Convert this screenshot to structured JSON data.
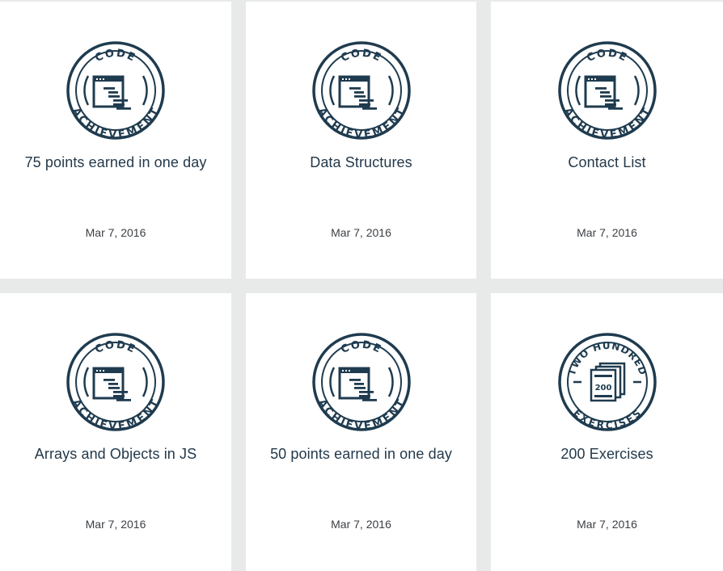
{
  "brand": {
    "badge_color": "#1f3b4f",
    "card_bg": "#ffffff",
    "page_bg": "#e8e9e9"
  },
  "achievements": [
    {
      "badge_type": "code-achievement",
      "badge_top_text": "CODE",
      "badge_bottom_text": "ACHIEVEMENT",
      "badge_number": "",
      "title": "75 points earned in one day",
      "date": "Mar 7, 2016"
    },
    {
      "badge_type": "code-achievement",
      "badge_top_text": "CODE",
      "badge_bottom_text": "ACHIEVEMENT",
      "badge_number": "",
      "title": "Data Structures",
      "date": "Mar 7, 2016"
    },
    {
      "badge_type": "code-achievement",
      "badge_top_text": "CODE",
      "badge_bottom_text": "ACHIEVEMENT",
      "badge_number": "",
      "title": "Contact List",
      "date": "Mar 7, 2016"
    },
    {
      "badge_type": "code-achievement",
      "badge_top_text": "CODE",
      "badge_bottom_text": "ACHIEVEMENT",
      "badge_number": "",
      "title": "Arrays and Objects in JS",
      "date": "Mar 7, 2016"
    },
    {
      "badge_type": "code-achievement",
      "badge_top_text": "CODE",
      "badge_bottom_text": "ACHIEVEMENT",
      "badge_number": "",
      "title": "50 points earned in one day",
      "date": "Mar 7, 2016"
    },
    {
      "badge_type": "exercises",
      "badge_top_text": "TWO HUNDRED",
      "badge_bottom_text": "EXERCISES",
      "badge_number": "200",
      "title": "200 Exercises",
      "date": "Mar 7, 2016"
    }
  ]
}
